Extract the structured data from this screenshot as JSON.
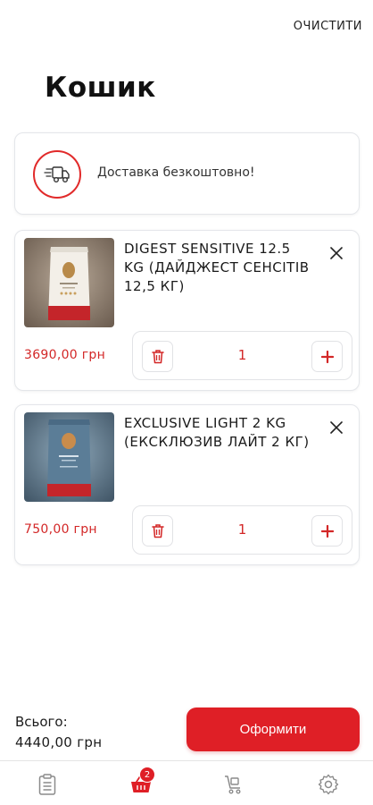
{
  "header": {
    "clear_label": "ОЧИСТИТИ",
    "title": "Кошик"
  },
  "delivery": {
    "icon": "delivery-truck-icon",
    "text": "Доставка безкоштовно!"
  },
  "items": [
    {
      "name": "DIGEST SENSITIVE 12.5  KG (ДАЙДЖЕСТ СЕНСІТІВ 12,5 КГ)",
      "price": "3690,00 грн",
      "quantity": "1",
      "image": "cat-food-bag-beige"
    },
    {
      "name": "EXCLUSIVE LIGHT  2 KG (ЕКСКЛЮЗИВ ЛАЙТ 2 КГ)",
      "price": "750,00 грн",
      "quantity": "1",
      "image": "cat-food-bag-blue"
    }
  ],
  "footer": {
    "total_label": "Всього:",
    "total_value": "4440,00 грн",
    "checkout_label": "Оформити"
  },
  "nav": {
    "cart_badge": "2",
    "items": [
      "orders-icon",
      "cart-icon",
      "catalog-icon",
      "settings-icon"
    ]
  },
  "colors": {
    "accent": "#df1f26",
    "price": "#d32727",
    "border": "#e4e6ea"
  }
}
